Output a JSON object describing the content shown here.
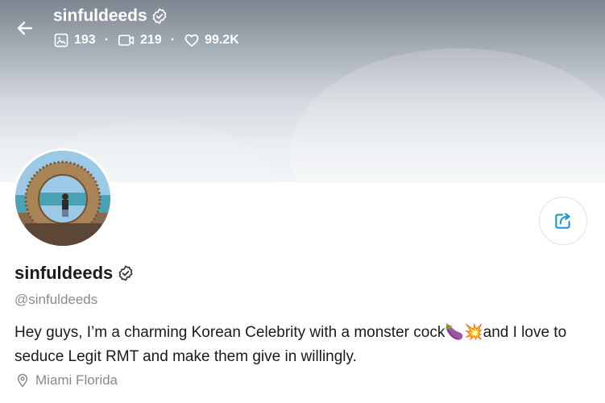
{
  "header": {
    "name": "sinfuldeeds",
    "stats": [
      {
        "icon": "image-icon",
        "value": "193"
      },
      {
        "icon": "video-icon",
        "value": "219"
      },
      {
        "icon": "heart-icon",
        "value": "99.2K"
      }
    ],
    "separator": "·"
  },
  "profile": {
    "name": "sinfuldeeds",
    "handle": "@sinfuldeeds",
    "bio": "Hey guys, I’m a charming Korean Celebrity with a monster cock🍆💥and I love to seduce Legit RMT and make them give in willingly.",
    "location": "Miami Florida"
  },
  "colors": {
    "accent": "#2196d8",
    "muted": "#8a8a8a"
  }
}
